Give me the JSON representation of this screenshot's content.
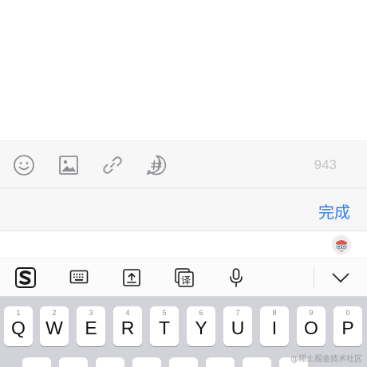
{
  "compose": {
    "char_count": "943"
  },
  "toolbar": {
    "icons": [
      "emoji-icon",
      "image-icon",
      "link-icon",
      "hashtag-icon"
    ]
  },
  "done_bar": {
    "done_label": "完成"
  },
  "ime_toolbar": {
    "icons": [
      "sogou-logo-icon",
      "keyboard-icon",
      "upload-icon",
      "translate-icon",
      "microphone-icon",
      "chevron-down-icon"
    ],
    "translate_glyph": "译"
  },
  "keyboard": {
    "row1": [
      {
        "letter": "Q",
        "num": "1"
      },
      {
        "letter": "W",
        "num": "2"
      },
      {
        "letter": "E",
        "num": "3"
      },
      {
        "letter": "R",
        "num": "4"
      },
      {
        "letter": "T",
        "num": "5"
      },
      {
        "letter": "Y",
        "num": "6"
      },
      {
        "letter": "U",
        "num": "7"
      },
      {
        "letter": "I",
        "num": "8"
      },
      {
        "letter": "O",
        "num": "9"
      },
      {
        "letter": "P",
        "num": "0"
      }
    ]
  },
  "watermark": "@稀土掘金技术社区",
  "colors": {
    "accent": "#2f80ed",
    "keyboard_bg": "#d1d3d9",
    "icon_gray": "#8e8e93"
  }
}
